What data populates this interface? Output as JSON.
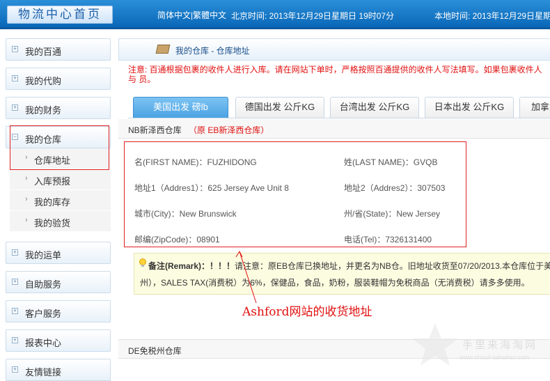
{
  "header": {
    "home_label": "物流中心首页",
    "lang_switch": "简体中文|繁體中文",
    "beijing_time": "北京时间: 2013年12月29日星期日 19时07分",
    "local_time": "本地时间: 2013年12月29日星期"
  },
  "sidebar": {
    "items": [
      {
        "label": "我的百通",
        "sign": "⊞"
      },
      {
        "label": "我的代购",
        "sign": "⊞"
      },
      {
        "label": "我的财务",
        "sign": "⊞"
      },
      {
        "label": "我的仓库",
        "sign": "⊟"
      },
      {
        "label": "我的运单",
        "sign": "⊞"
      },
      {
        "label": "自助服务",
        "sign": "⊞"
      },
      {
        "label": "客户服务",
        "sign": "⊞"
      },
      {
        "label": "报表中心",
        "sign": "⊞"
      },
      {
        "label": "友情链接",
        "sign": "⊞"
      }
    ],
    "sub_items": [
      "仓库地址",
      "入库预报",
      "我的库存",
      "我的验货"
    ]
  },
  "page": {
    "title": "我的仓库 - 仓库地址",
    "notice": "注意: 百通根据包裹的收件人进行入库。请在网站下单时，严格按照百通提供的收件人写法填写。如果包裹收件人与 员。"
  },
  "tabs": [
    {
      "label": "美国出发 磅lb"
    },
    {
      "label": "德国出发 公斤KG"
    },
    {
      "label": "台湾出发 公斤KG"
    },
    {
      "label": "日本出发 公斤KG"
    },
    {
      "label": "加拿大"
    }
  ],
  "warehouse_nb": {
    "name": "NB新泽西仓库",
    "subtitle": "（原 EB新泽西仓库）",
    "fields": {
      "first_name": "名(FIRST NAME)：FUZHIDONG",
      "last_name": "姓(LAST NAME)：GVQB",
      "address1": "地址1（Addres1）：625 Jersey Ave Unit 8",
      "address2": "地址2（Addres2）：307503",
      "city": "城市(City)：New Brunswick",
      "state": "州/省(State)：New Jersey",
      "zip": "邮编(ZipCode)：08901",
      "tel": "电话(Tel)：7326131400"
    },
    "remark_label": "备注(Remark)：！！！",
    "remark_line1": "请注意：原EB仓库已换地址，并更名为NB仓。旧地址收货至07/20/2013.本仓库位于美",
    "remark_line2": "州），SALES TAX(消费税）为6%，保健品，食品，奶粉，服装鞋帽为免税商品（无消费税）请多多使用。"
  },
  "annotation": "Ashford网站的收货地址",
  "warehouse_de": {
    "name": "DE免税州仓库"
  },
  "watermark": {
    "text": "手里来海淘网",
    "url": "www.shouli laihaitao.com"
  },
  "colors": {
    "header_blue": "#0a67b8",
    "active_tab": "#4ba2e2",
    "notice_red": "#e01010",
    "remark_bg": "#fcfce1"
  }
}
